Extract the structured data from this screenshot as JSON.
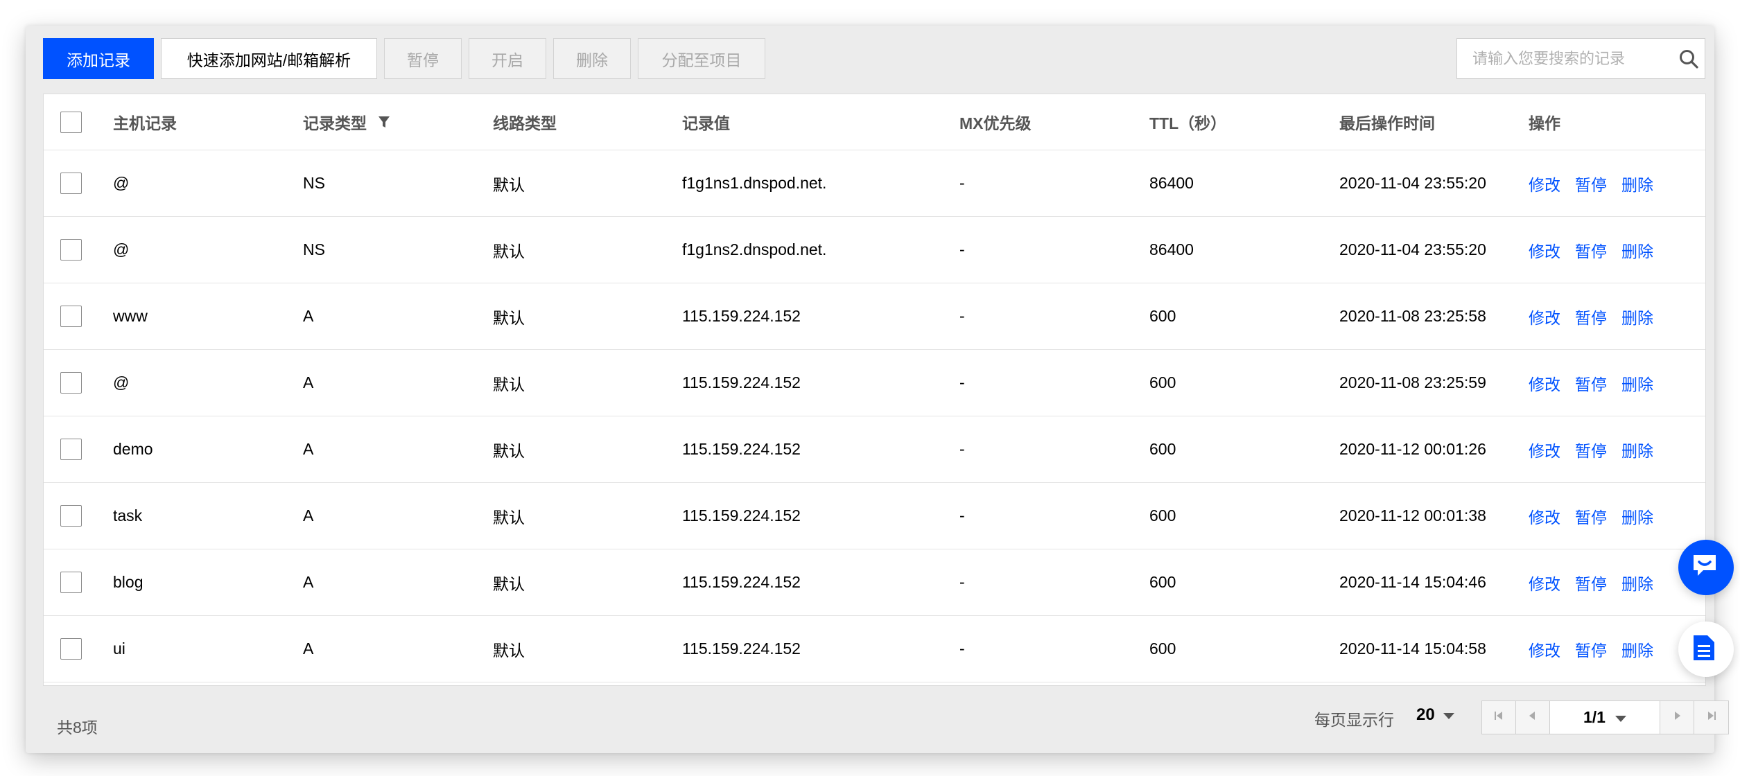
{
  "toolbar": {
    "add_record": "添加记录",
    "quick_add": "快速添加网站/邮箱解析",
    "pause": "暂停",
    "enable": "开启",
    "delete": "删除",
    "assign": "分配至项目"
  },
  "search": {
    "placeholder": "请输入您要搜索的记录"
  },
  "table": {
    "headers": {
      "host": "主机记录",
      "type": "记录类型",
      "line": "线路类型",
      "value": "记录值",
      "mx": "MX优先级",
      "ttl": "TTL（秒）",
      "time": "最后操作时间",
      "ops": "操作"
    },
    "ops": {
      "edit": "修改",
      "pause": "暂停",
      "delete": "删除"
    },
    "rows": [
      {
        "host": "@",
        "type": "NS",
        "line": "默认",
        "value": "f1g1ns1.dnspod.net.",
        "mx": "-",
        "ttl": "86400",
        "time": "2020-11-04 23:55:20"
      },
      {
        "host": "@",
        "type": "NS",
        "line": "默认",
        "value": "f1g1ns2.dnspod.net.",
        "mx": "-",
        "ttl": "86400",
        "time": "2020-11-04 23:55:20"
      },
      {
        "host": "www",
        "type": "A",
        "line": "默认",
        "value": "115.159.224.152",
        "mx": "-",
        "ttl": "600",
        "time": "2020-11-08 23:25:58"
      },
      {
        "host": "@",
        "type": "A",
        "line": "默认",
        "value": "115.159.224.152",
        "mx": "-",
        "ttl": "600",
        "time": "2020-11-08 23:25:59"
      },
      {
        "host": "demo",
        "type": "A",
        "line": "默认",
        "value": "115.159.224.152",
        "mx": "-",
        "ttl": "600",
        "time": "2020-11-12 00:01:26"
      },
      {
        "host": "task",
        "type": "A",
        "line": "默认",
        "value": "115.159.224.152",
        "mx": "-",
        "ttl": "600",
        "time": "2020-11-12 00:01:38"
      },
      {
        "host": "blog",
        "type": "A",
        "line": "默认",
        "value": "115.159.224.152",
        "mx": "-",
        "ttl": "600",
        "time": "2020-11-14 15:04:46"
      },
      {
        "host": "ui",
        "type": "A",
        "line": "默认",
        "value": "115.159.224.152",
        "mx": "-",
        "ttl": "600",
        "time": "2020-11-14 15:04:58"
      }
    ]
  },
  "footer": {
    "total": "共8项",
    "per_page_label": "每页显示行",
    "per_page_value": "20",
    "page_indicator": "1/1"
  },
  "colors": {
    "accent": "#0052ff",
    "shell": "#ececec"
  },
  "icons": {
    "search": "search-icon",
    "filter": "filter-icon",
    "caret": "caret-down-icon",
    "first": "first-page-icon",
    "prev": "prev-page-icon",
    "next": "next-page-icon",
    "last": "last-page-icon",
    "chat": "chat-icon",
    "doc": "document-icon"
  }
}
